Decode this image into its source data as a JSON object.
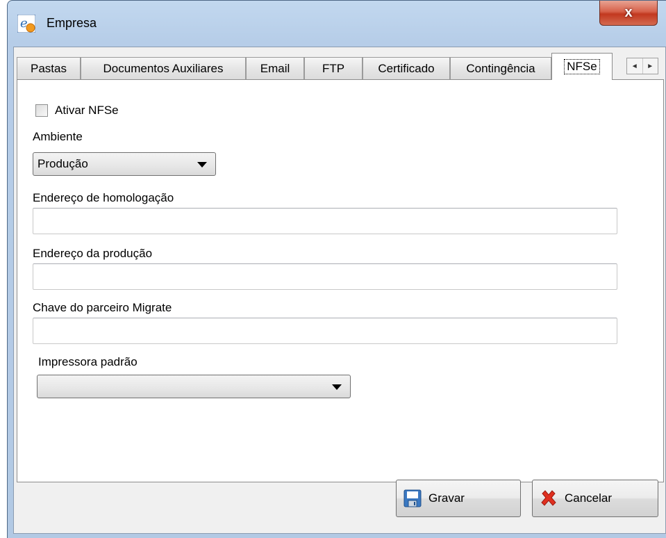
{
  "window": {
    "title": "Empresa",
    "close_label": "x"
  },
  "tabs": [
    {
      "label": "Pastas"
    },
    {
      "label": "Documentos Auxiliares"
    },
    {
      "label": "Email"
    },
    {
      "label": "FTP"
    },
    {
      "label": "Certificado"
    },
    {
      "label": "Contingência"
    },
    {
      "label": "NFSe"
    }
  ],
  "tab_scroll": {
    "left": "◄",
    "right": "►"
  },
  "form": {
    "ativar_label": "Ativar NFSe",
    "ativar_checked": false,
    "ambiente_label": "Ambiente",
    "ambiente_value": "Produção",
    "homologacao_label": "Endereço de homologação",
    "homologacao_value": "",
    "producao_label": "Endereço da produção",
    "producao_value": "",
    "chave_label": "Chave do parceiro Migrate",
    "chave_value": "",
    "impressora_label": "Impressora padrão",
    "impressora_value": ""
  },
  "buttons": {
    "save_label": "Gravar",
    "cancel_label": "Cancelar"
  },
  "colors": {
    "frame": "#b6cde8",
    "close": "#c2381f",
    "cancel_icon": "#e03020",
    "save_icon": "#2f6fb5"
  }
}
